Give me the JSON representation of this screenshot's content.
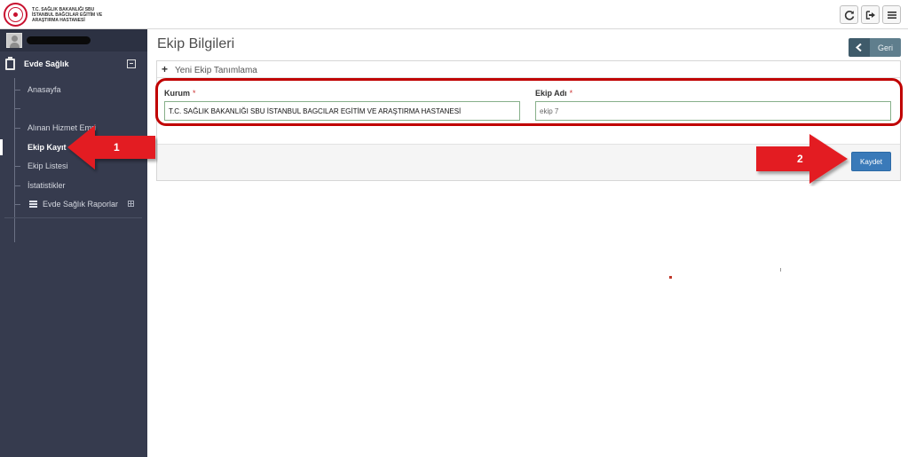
{
  "header": {
    "logo_lines": [
      "T.C. SAĞLIK BAKANLIĞI SBU",
      "İSTANBUL BAĞCILAR EĞİTİM VE",
      "ARAŞTIRMA HASTANESİ"
    ],
    "buttons": [
      {
        "name": "refresh-icon"
      },
      {
        "name": "logout-icon"
      },
      {
        "name": "hamburger-menu-icon"
      }
    ]
  },
  "sidebar": {
    "section_label": "Evde Sağlık",
    "items": [
      {
        "label": "Anasayfa"
      },
      {
        "label": ""
      },
      {
        "label": "Alınan Hizmet Emri"
      },
      {
        "label": "Ekip Kayıt"
      },
      {
        "label": "Ekip Listesi"
      },
      {
        "label": "İstatistikler"
      },
      {
        "label": "Evde Sağlık Raporlar"
      }
    ]
  },
  "main": {
    "title": "Ekip Bilgileri",
    "back_label": "Geri",
    "panel_title": "Yeni Ekip Tanımlama",
    "fields": {
      "kurum_label": "Kurum",
      "kurum_value": "T.C. SAĞLIK BAKANLIĞI SBU İSTANBUL BAGCILAR EGİTİM VE ARAŞTIRMA HASTANESİ",
      "ekip_label": "Ekip Adı",
      "ekip_value": "ekip 7",
      "required_mark": "*"
    },
    "save_label": "Kaydet"
  },
  "annotations": {
    "arrow1_number": "1",
    "arrow2_number": "2",
    "color": "#e31e24"
  }
}
